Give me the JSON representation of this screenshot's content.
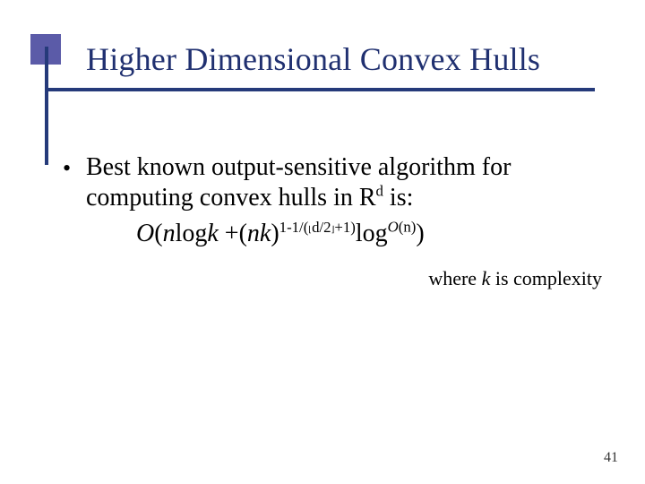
{
  "title": "Higher Dimensional Convex Hulls",
  "bullet": {
    "line1": "Best known output-sensitive algorithm for",
    "line2_pre": "computing convex hulls in R",
    "line2_sup": "d",
    "line2_post": " is:"
  },
  "formula": {
    "O": "O",
    "open": "(",
    "n1": "n",
    "log1": "log",
    "k1": "k",
    "plus1": " +(",
    "n2": "n",
    "k2": "k",
    "close_nk": ")",
    "exp_a": "1-1/(",
    "floor_l": "⌊",
    "exp_mid": "d/2",
    "floor_r": "⌋",
    "exp_b": "+1)",
    "log2": "log",
    "exp_O": "O",
    "exp_On": "(n)",
    "close": ")"
  },
  "note_pre": "where ",
  "note_k": "k",
  "note_post": " is complexity",
  "page_number": "41"
}
